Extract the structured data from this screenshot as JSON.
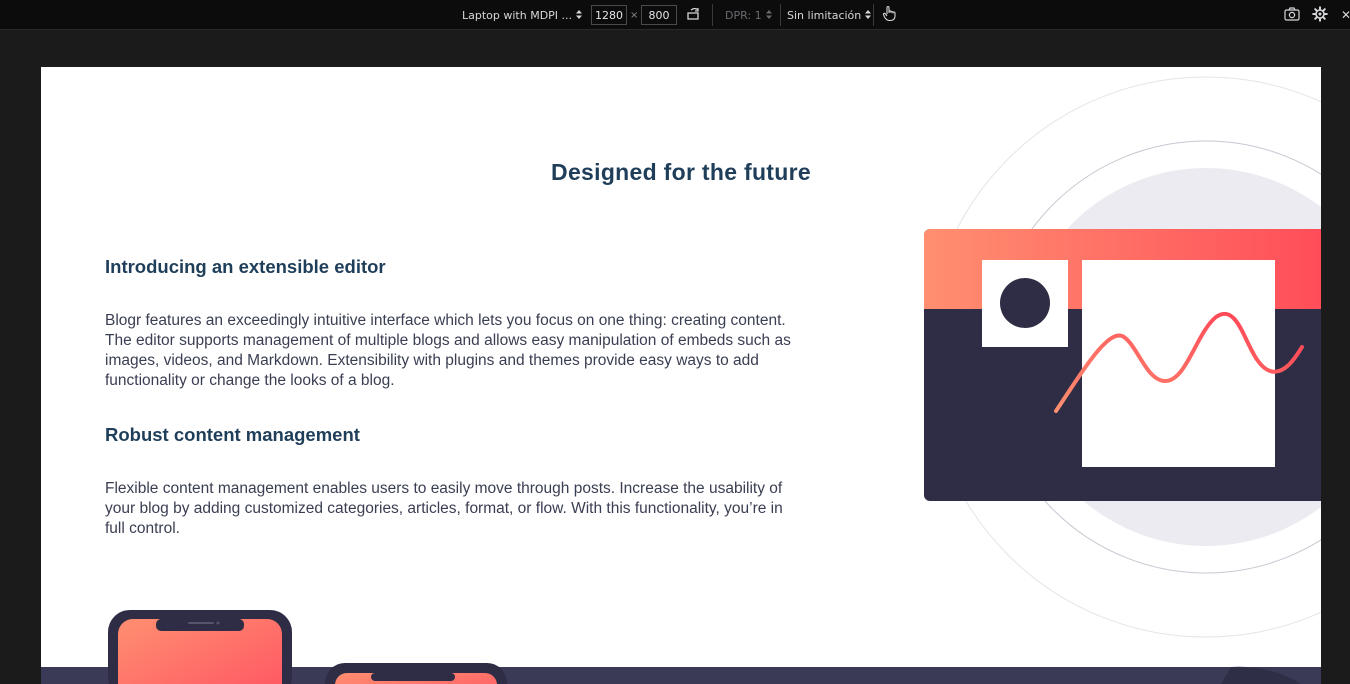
{
  "devtools": {
    "device_label": "Laptop with MDPI ...",
    "width_value": "1280",
    "times_sign": "×",
    "height_value": "800",
    "dpr_label": "DPR: 1",
    "throttle_label": "Sin limitación",
    "icons": {
      "rotate": "rotate-icon",
      "touch": "touch-icon",
      "screenshot": "camera-icon",
      "settings": "gear-icon",
      "close": "close-icon"
    }
  },
  "page": {
    "section_title": "Designed for the future",
    "features": [
      {
        "heading": "Introducing an extensible editor",
        "body": "Blogr features an exceedingly intuitive interface which lets you focus on one thing: creating content. The editor supports management of multiple blogs and allows easy manipulation of embeds such as images, videos, and Markdown. Extensibility with plugins and themes provide easy ways to add functionality or change the looks of a blog."
      },
      {
        "heading": "Robust content management",
        "body": "Flexible content management enables users to easily move through posts. Increase the usability of your blog by adding customized categories, articles, format, or flow. With this functionality, you’re in full control."
      }
    ]
  },
  "colors": {
    "heading": "#1f3e5a",
    "body_text": "#3a3e52",
    "dark_panel": "#2e2d45",
    "gradient_start": "#ff8f70",
    "gradient_end": "#ff3e54"
  }
}
